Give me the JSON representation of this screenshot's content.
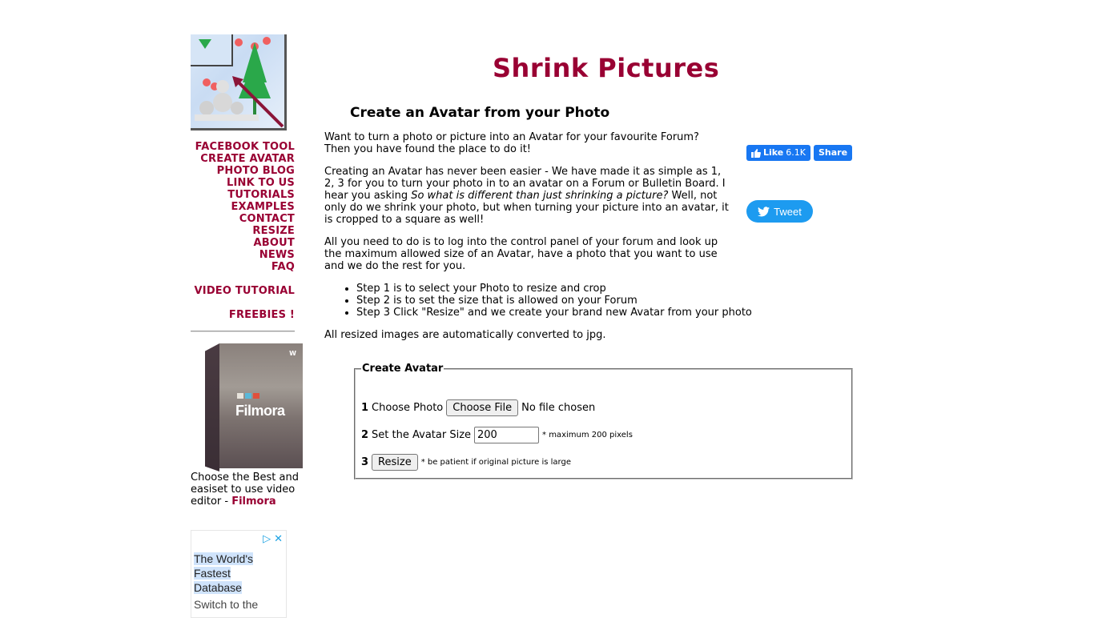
{
  "site": {
    "title": "Shrink Pictures",
    "logo_alt": "Shrink Pictures logo"
  },
  "sidebar": {
    "nav_items": [
      {
        "label": "FACEBOOK TOOL"
      },
      {
        "label": "CREATE AVATAR"
      },
      {
        "label": "PHOTO BLOG"
      },
      {
        "label": "LINK TO US"
      },
      {
        "label": "TUTORIALS"
      },
      {
        "label": "EXAMPLES"
      },
      {
        "label": "CONTACT"
      },
      {
        "label": "RESIZE"
      },
      {
        "label": "ABOUT"
      },
      {
        "label": "NEWS"
      },
      {
        "label": "FAQ"
      }
    ],
    "video_tutorial": "VIDEO TUTORIAL",
    "freebies": "FREEBIES !",
    "promo": {
      "product_name": "Filmora",
      "publisher": "wondershare",
      "text": "Choose the Best and easiset to use video editor - ",
      "link": "Filmora"
    },
    "ad": {
      "headline_lines": [
        "The World's",
        "Fastest",
        "Database"
      ],
      "body": "Switch to the",
      "adchoices_icon": "adchoices-icon",
      "close_icon": "close-icon"
    }
  },
  "main": {
    "subtitle": "Create an Avatar from your Photo",
    "intro_line1": "Want to turn a photo or picture into an Avatar for your favourite Forum?",
    "intro_line2": "Then you have found the place to do it!",
    "para2_start": "Creating an Avatar has never been easier - We have made it as simple as 1, 2, 3 for you to turn your photo in to an avatar on a Forum or Bulletin Board.  I hear you asking ",
    "para2_italic": "So what is different than just shrinking a picture?",
    "para2_end": "  Well, not only do we shrink your photo, but when turning your picture into an avatar, it is cropped to a square as well!",
    "para3": "All you need to do is to log into the control panel of your forum and look up the maximum allowed size of an Avatar, have a photo that you want to use and we do the rest for you.",
    "steps": [
      "Step 1 is to select your Photo to resize and crop",
      "Step 2 is to set the size that is allowed on your Forum",
      "Step 3 Click \"Resize\" and we create your brand new Avatar from your photo"
    ],
    "converted_note": "All resized images are automatically converted to jpg."
  },
  "social": {
    "like_label": "Like",
    "like_count": "6.1K",
    "share_label": "Share",
    "tweet_label": "Tweet",
    "colors": {
      "facebook": "#1877f2",
      "twitter": "#1d9bf0"
    }
  },
  "form": {
    "legend": "Create Avatar",
    "step1_num": "1",
    "step1_label": "Choose Photo",
    "choose_file_label": "Choose File",
    "no_file_text": "No file chosen",
    "step2_num": "2",
    "step2_label": "Set the Avatar Size",
    "size_value": "200",
    "size_note": "* maximum 200 pixels",
    "step3_num": "3",
    "resize_label": "Resize",
    "resize_note": "* be patient if original picture is large"
  },
  "colors": {
    "brand": "#990033"
  }
}
